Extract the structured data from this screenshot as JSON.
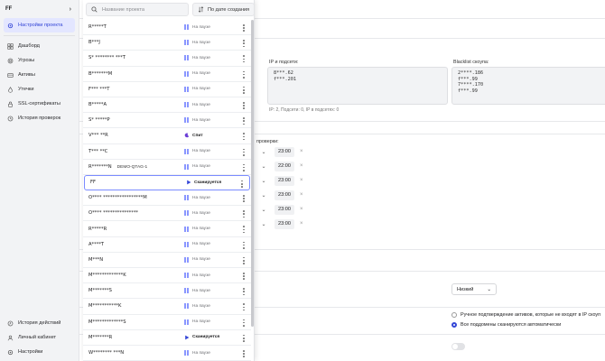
{
  "sidebar": {
    "org_name": "FF",
    "items": [
      {
        "label": "Настройки проекта",
        "icon": "gear-icon",
        "active": true
      },
      {
        "label": "Дашборд",
        "icon": "dashboard-icon"
      },
      {
        "label": "Угрозы",
        "icon": "threats-icon"
      },
      {
        "label": "Активы",
        "icon": "assets-icon"
      },
      {
        "label": "Утечки",
        "icon": "leaks-icon"
      },
      {
        "label": "SSL-сертификаты",
        "icon": "ssl-icon"
      },
      {
        "label": "История проверок",
        "icon": "history-icon"
      }
    ],
    "bottom_items": [
      {
        "label": "История действий",
        "icon": "activity-icon"
      },
      {
        "label": "Личный кабинет",
        "icon": "user-icon"
      },
      {
        "label": "Настройки",
        "icon": "settings-icon"
      }
    ]
  },
  "dropdown": {
    "search_placeholder": "Название проекта",
    "sort_label": "По дате создания",
    "projects": [
      {
        "name": "R*****T",
        "status": "На паузе",
        "state": "paused"
      },
      {
        "name": "B***J",
        "status": "На паузе",
        "state": "paused"
      },
      {
        "name": "S* ******** ***T",
        "status": "На паузе",
        "state": "paused"
      },
      {
        "name": "B*******M",
        "status": "На паузе",
        "state": "paused"
      },
      {
        "name": "F*** ***T",
        "status": "На паузе",
        "state": "paused"
      },
      {
        "name": "B*****A",
        "status": "На паузе",
        "state": "paused"
      },
      {
        "name": "S* *****P",
        "status": "На паузе",
        "state": "paused"
      },
      {
        "name": "V*** **R",
        "status": "Спит",
        "state": "sleep"
      },
      {
        "name": "T*** **C",
        "status": "На паузе",
        "state": "paused"
      },
      {
        "name": "R*******N",
        "tag": "DEMO-QTAG-1",
        "status": "На паузе",
        "state": "paused"
      },
      {
        "name": "FF",
        "status": "Сканируется",
        "state": "scanning",
        "selected": true
      },
      {
        "name": "O**** *****************M",
        "status": "На паузе",
        "state": "paused"
      },
      {
        "name": "O**** ***************",
        "status": "На паузе",
        "state": "paused"
      },
      {
        "name": "R*****R",
        "status": "На паузе",
        "state": "paused"
      },
      {
        "name": "A****T",
        "status": "На паузе",
        "state": "paused"
      },
      {
        "name": "M***N",
        "status": "На паузе",
        "state": "paused"
      },
      {
        "name": "M*************K",
        "status": "На паузе",
        "state": "paused"
      },
      {
        "name": "M*******S",
        "status": "На паузе",
        "state": "paused"
      },
      {
        "name": "M***********K",
        "status": "На паузе",
        "state": "paused"
      },
      {
        "name": "M*************S",
        "status": "На паузе",
        "state": "paused"
      },
      {
        "name": "M*******R",
        "status": "Сканируется",
        "state": "scanning"
      },
      {
        "name": "W******** ***N",
        "status": "На паузе",
        "state": "paused"
      }
    ]
  },
  "main": {
    "ip_label": "IP и подсети:",
    "ip_values": "8***.62\nf***.201",
    "ip_hint": "IP: 2, Подсети: 0, IP в подсетях: 0",
    "blacklist_label": "Blacklist скоупа:",
    "blacklist_values": "2****.186\nf***.99\n7****.170\nf***.99",
    "check_label": "проверки:",
    "times": [
      "23:00",
      "22:00",
      "23:00",
      "23:00",
      "23:00",
      "23:00"
    ],
    "priority_value": "Низкий",
    "radio_manual": "Ручное подтверждение активов, которые не входят в IP скоуп",
    "radio_auto": "Все поддомены сканируются автоматически"
  },
  "colors": {
    "accent": "#3446d6",
    "paused_icon": "#8a97ff",
    "sleep_icon": "#6b3fd6",
    "sidebar_bg": "#f2f3f5"
  }
}
